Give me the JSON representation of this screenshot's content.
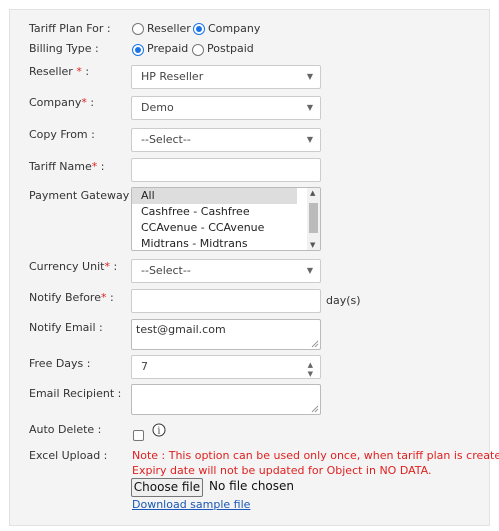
{
  "tariff_plan_for": {
    "label": "Tariff Plan For :",
    "options": [
      "Reseller",
      "Company"
    ],
    "selected": "Company"
  },
  "billing_type": {
    "label": "Billing Type :",
    "options": [
      "Prepaid",
      "Postpaid"
    ],
    "selected": "Prepaid"
  },
  "reseller": {
    "label": "Reseller",
    "required_mark": "*",
    "suffix": ":",
    "value": "HP Reseller"
  },
  "company": {
    "label": "Company",
    "required_mark": "*",
    "suffix": ":",
    "value": "Demo"
  },
  "copy_from": {
    "label": "Copy From :",
    "value": "--Select--"
  },
  "tariff_name": {
    "label": "Tariff Name",
    "required_mark": "*",
    "suffix": ":",
    "value": ""
  },
  "payment_gateway": {
    "label": "Payment Gateway :",
    "options": [
      "All",
      "Cashfree - Cashfree",
      "CCAvenue - CCAvenue",
      "Midtrans - Midtrans"
    ],
    "selected": "All"
  },
  "currency_unit": {
    "label": "Currency Unit",
    "required_mark": "*",
    "suffix": ":",
    "value": "--Select--"
  },
  "notify_before": {
    "label": "Notify Before",
    "required_mark": "*",
    "suffix": ":",
    "value": "",
    "unit": "day(s)"
  },
  "notify_email": {
    "label": "Notify Email :",
    "value": "test@gmail.com"
  },
  "free_days": {
    "label": "Free Days :",
    "value": "7"
  },
  "email_recipient": {
    "label": "Email Recipient :",
    "value": ""
  },
  "auto_delete": {
    "label": "Auto Delete :",
    "checked": false,
    "info_glyph": "i"
  },
  "excel_upload": {
    "label": "Excel Upload :",
    "note_line1": "Note : This option can be used only once, when tariff plan is created.",
    "note_line2": "Expiry date will not be updated for Object in NO DATA.",
    "choose_file": "Choose file",
    "no_file": "No file chosen",
    "download_link": "Download sample file"
  },
  "colors": {
    "required": "#e02020",
    "link": "#1a57b6",
    "radio_accent": "#1a73e8",
    "panel_bg": "#f4f4f4"
  }
}
